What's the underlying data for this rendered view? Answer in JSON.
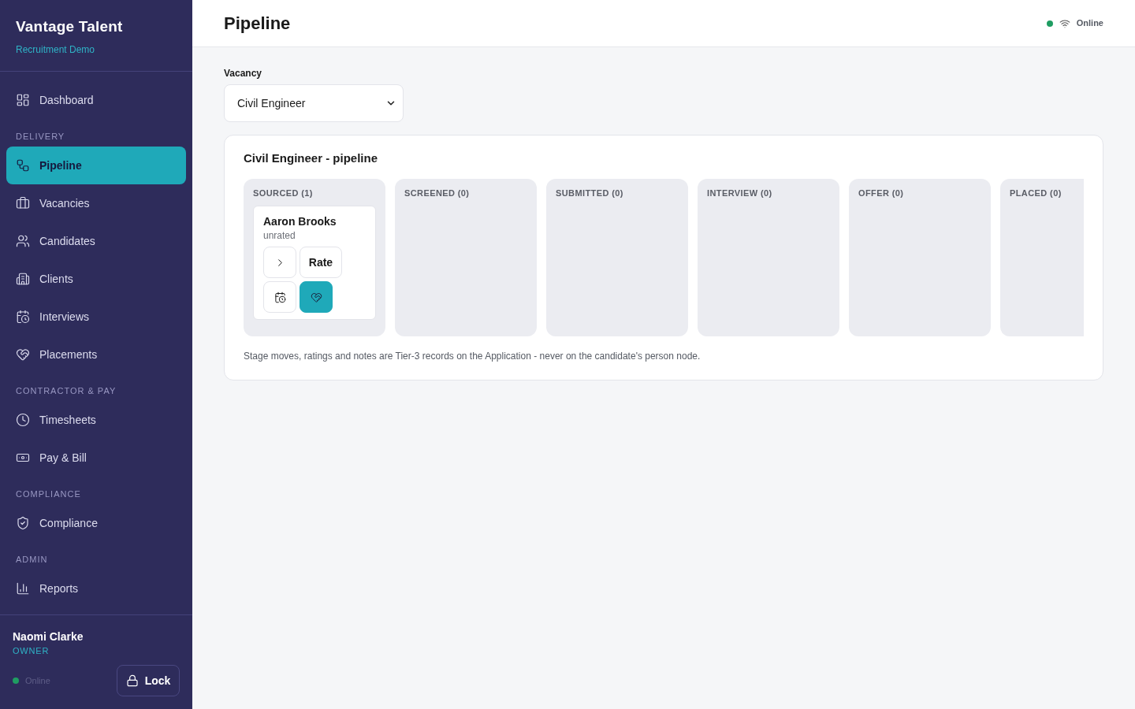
{
  "sidebar": {
    "brand": {
      "title": "Vantage Talent",
      "subtitle": "Recruitment Demo"
    },
    "nav": [
      {
        "items": [
          {
            "label": "Dashboard",
            "selected": false
          }
        ]
      },
      {
        "heading": "DELIVERY",
        "items": [
          {
            "label": "Pipeline",
            "selected": true
          },
          {
            "label": "Vacancies",
            "selected": false
          },
          {
            "label": "Candidates",
            "selected": false
          },
          {
            "label": "Clients",
            "selected": false
          },
          {
            "label": "Interviews",
            "selected": false
          },
          {
            "label": "Placements",
            "selected": false
          }
        ]
      },
      {
        "heading": "CONTRACTOR & PAY",
        "items": [
          {
            "label": "Timesheets",
            "selected": false
          },
          {
            "label": "Pay & Bill",
            "selected": false
          }
        ]
      },
      {
        "heading": "COMPLIANCE",
        "items": [
          {
            "label": "Compliance",
            "selected": false
          }
        ]
      },
      {
        "heading": "ADMIN",
        "items": [
          {
            "label": "Reports",
            "selected": false
          }
        ]
      }
    ],
    "user": {
      "name": "Naomi Clarke",
      "role": "OWNER",
      "status": {
        "label": "Online",
        "online": true
      }
    },
    "lock_button": "Lock"
  },
  "header": {
    "title": "Pipeline",
    "status": {
      "label": "Online",
      "online": true
    }
  },
  "vacancy": {
    "label": "Vacancy",
    "value": "Civil Engineer"
  },
  "pipeline": {
    "title": "Civil Engineer - pipeline",
    "stages": [
      {
        "label": "SOURCED (1)",
        "cards": [
          {
            "name": "Aaron Brooks",
            "rating": "unrated",
            "actions": [
              {
                "kind": "icon",
                "primary": false
              },
              {
                "kind": "text",
                "label": "Rate",
                "primary": false
              },
              {
                "kind": "icon",
                "primary": false
              },
              {
                "kind": "icon",
                "primary": true
              }
            ]
          }
        ]
      },
      {
        "label": "SCREENED (0)"
      },
      {
        "label": "SUBMITTED (0)"
      },
      {
        "label": "INTERVIEW (0)"
      },
      {
        "label": "OFFER (0)"
      },
      {
        "label": "PLACED (0)"
      }
    ],
    "note": "Stage moves, ratings and notes are Tier-3 records on the Application - never on the candidate's person node."
  }
}
